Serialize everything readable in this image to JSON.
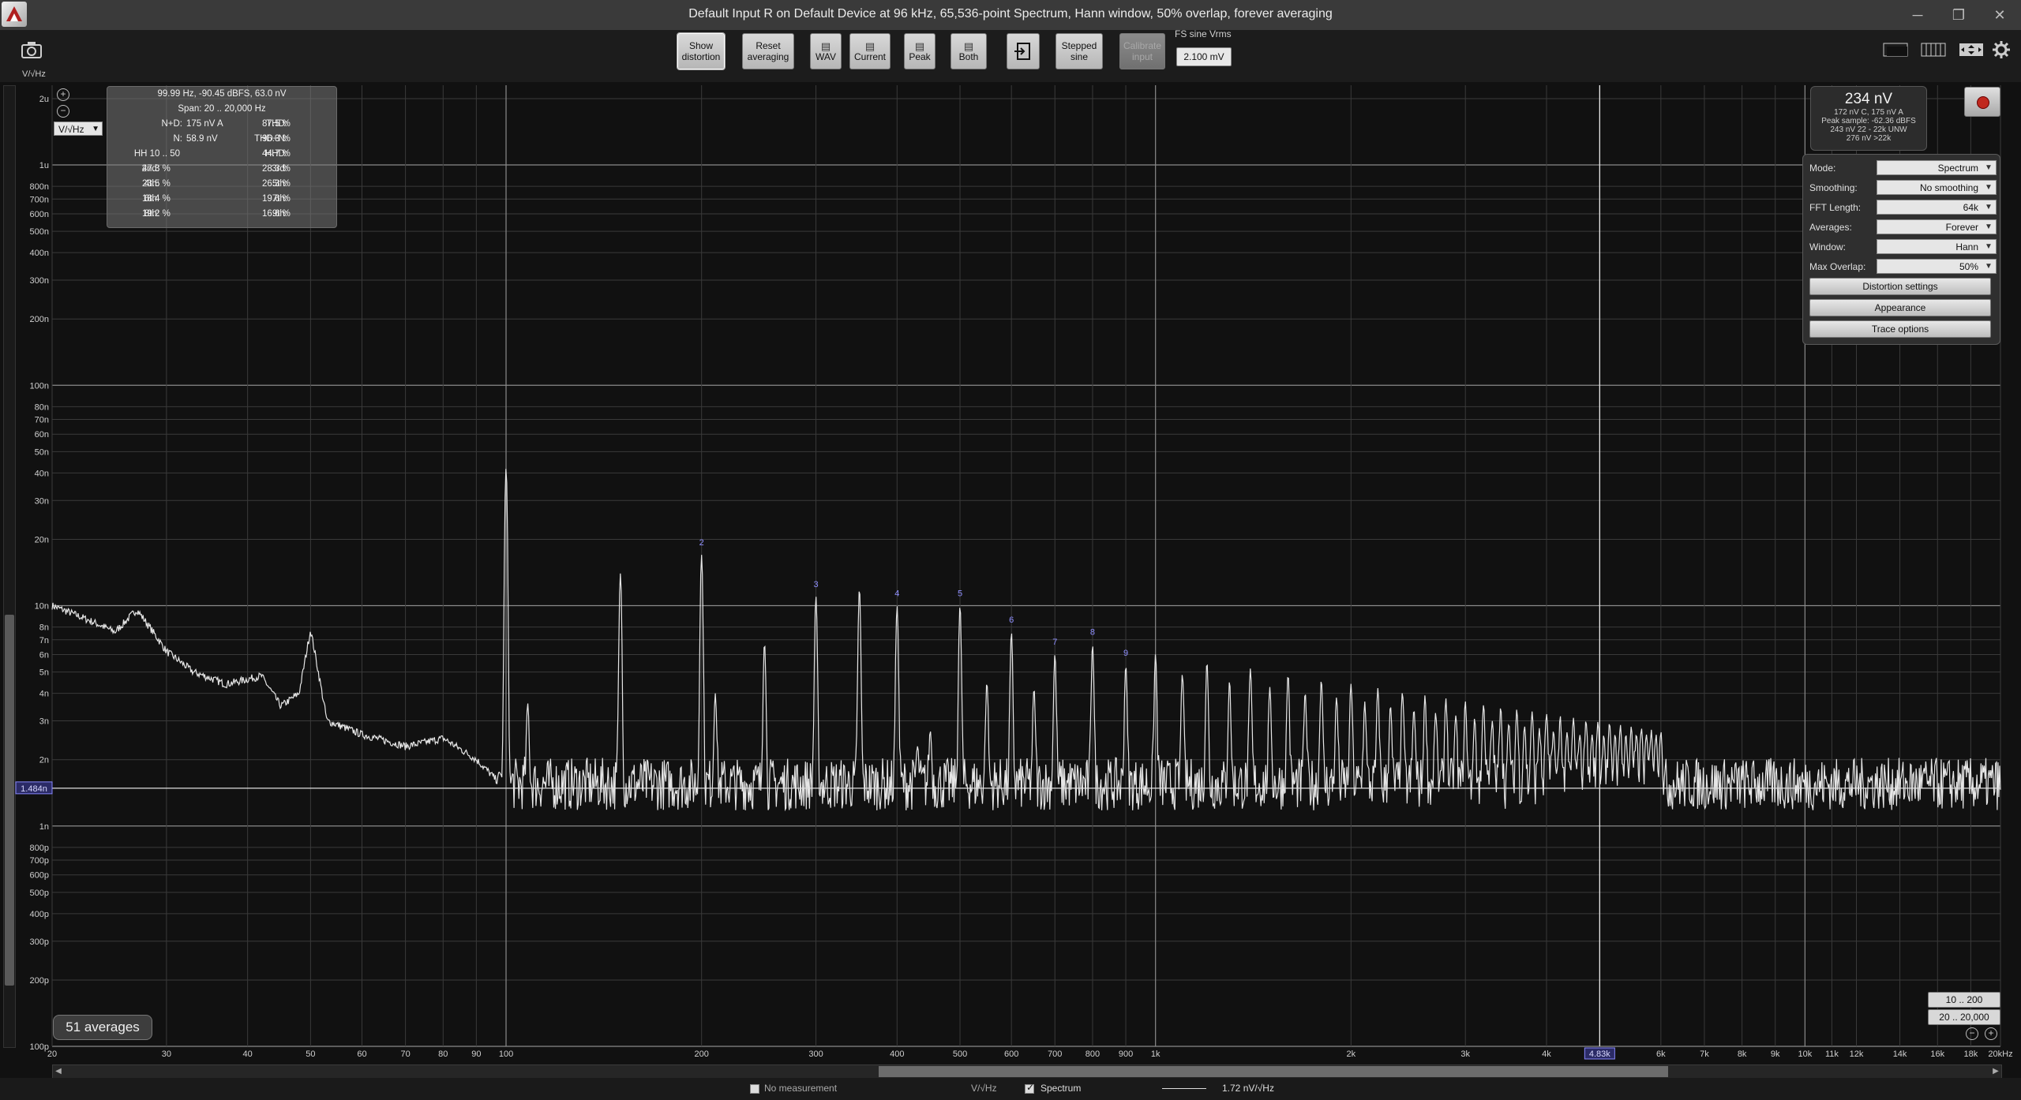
{
  "window": {
    "title": "Default Input R on Default Device at 96 kHz, 65,536-point Spectrum, Hann window, 50% overlap, forever averaging",
    "controls": [
      "─",
      "❐",
      "✕"
    ]
  },
  "toolbar": {
    "buttons": [
      {
        "name": "show-distortion",
        "label": "Show\ndistortion"
      },
      {
        "name": "reset-averaging",
        "label": "Reset\naveraging"
      },
      {
        "name": "wav",
        "label": "WAV"
      },
      {
        "name": "current",
        "label": "Current"
      },
      {
        "name": "peak",
        "label": "Peak"
      },
      {
        "name": "both",
        "label": "Both"
      },
      {
        "name": "import",
        "label": ""
      },
      {
        "name": "stepped-sine",
        "label": "Stepped\nsine"
      },
      {
        "name": "calibrate-input",
        "label": "Calibrate\ninput"
      }
    ],
    "fs_label": "FS sine Vrms",
    "fs_value": "2.100 mV"
  },
  "plot": {
    "y_unit_label": "V/√Hz",
    "y_unit_select": "V/√Hz",
    "y_ticks": [
      "2u",
      "1u",
      "800n",
      "700n",
      "600n",
      "500n",
      "400n",
      "300n",
      "200n",
      "100n",
      "80n",
      "70n",
      "60n",
      "50n",
      "40n",
      "30n",
      "20n",
      "10n",
      "8n",
      "7n",
      "6n",
      "5n",
      "4n",
      "3n",
      "2n",
      "1n",
      "800p",
      "700p",
      "600p",
      "500p",
      "400p",
      "300p",
      "200p",
      "100p"
    ],
    "x_ticks": [
      "20",
      "30",
      "40",
      "50",
      "60",
      "70",
      "80",
      "90",
      "100",
      "200",
      "300",
      "400",
      "500",
      "600",
      "700",
      "800",
      "900",
      "1k",
      "2k",
      "3k",
      "4k",
      "6k",
      "7k",
      "8k",
      "9k",
      "10k",
      "11k",
      "12k",
      "14k",
      "16k",
      "18k",
      "20kHz"
    ],
    "cursor_freq_label": "4.83k",
    "level_line_label": "1.484n",
    "harmonic_labels": [
      "2",
      "3",
      "4",
      "5",
      "6",
      "7",
      "8",
      "9"
    ]
  },
  "distortion": {
    "header": "99.99 Hz, -90.45 dBFS, 63.0 nV",
    "span": "Span: 20 .. 20,000 Hz",
    "rows": [
      [
        "N+D:",
        "175 nV A",
        "THD:",
        "87.5 %"
      ],
      [
        "N:",
        "58.9 nV",
        "THD+N:",
        "96.3 %"
      ],
      [
        "HH 10 .. 50",
        "",
        "HHD:",
        "44.7 %"
      ],
      [
        "2nd:",
        "47.3 %",
        "3rd:",
        "28.3 %"
      ],
      [
        "4th:",
        "23.5 %",
        "5th:",
        "26.3 %"
      ],
      [
        "6th:",
        "18.4 %",
        "7th:",
        "19.6 %"
      ],
      [
        "8th:",
        "19.2 %",
        "9th:",
        "16.6 %"
      ]
    ]
  },
  "level": {
    "main": "234 nV",
    "sub1": "172 nV C, 175 nV A",
    "sub2": "Peak sample: -62.36 dBFS",
    "sub3": "243 nV 22 - 22k UNW",
    "sub4": "276 nV >22k"
  },
  "settings": {
    "rows": [
      {
        "label": "Mode:",
        "value": "Spectrum"
      },
      {
        "label": "Smoothing:",
        "value": "No smoothing"
      },
      {
        "label": "FFT Length:",
        "value": "64k"
      },
      {
        "label": "Averages:",
        "value": "Forever"
      },
      {
        "label": "Window:",
        "value": "Hann"
      },
      {
        "label": "Max Overlap:",
        "value": "50%"
      }
    ],
    "buttons": [
      "Distortion settings",
      "Appearance",
      "Trace options"
    ]
  },
  "bottom": {
    "averages": "51 averages",
    "range1": "10 .. 200",
    "range2": "20 .. 20,000"
  },
  "status": {
    "no_measurement": "No measurement",
    "unit": "V/√Hz",
    "spectrum": "Spectrum",
    "value": "1.72 nV/√Hz"
  },
  "colors": {
    "background": "#111111",
    "grid": "#3a3a3a",
    "trace": "#e6e6e6",
    "harmonic_label": "#8f8fff"
  }
}
